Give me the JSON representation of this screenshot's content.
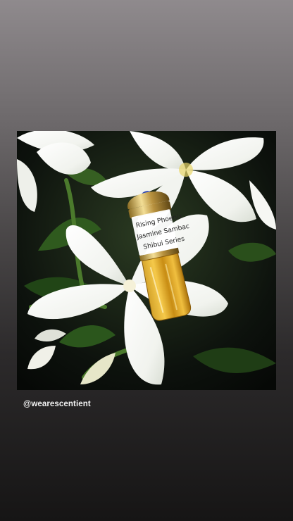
{
  "story": {
    "username_tag": "@wearescentient"
  },
  "photo": {
    "alt_description": "",
    "bottle_label": {
      "line1": "Rising Phoenix",
      "line2": "Jasmine Sambac",
      "line3": "Shibui Series"
    }
  },
  "colors": {
    "background_top": "#8f8a8d",
    "background_bottom": "#161515",
    "caption_text": "#f3f3f3"
  }
}
